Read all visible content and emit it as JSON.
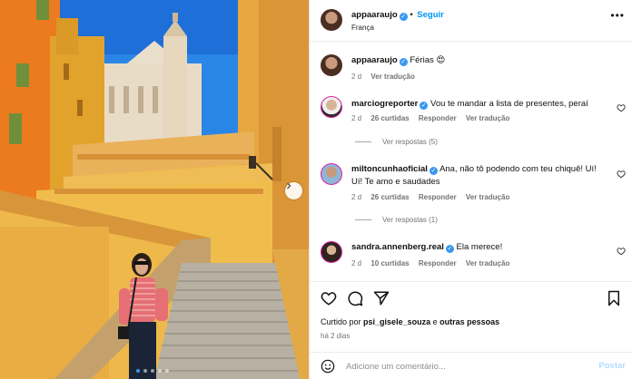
{
  "post": {
    "author": "appaaraujo",
    "follow_label": "Seguir",
    "location": "França",
    "caption_text": "Férias",
    "caption_emoji": "😍",
    "caption_time": "2 d",
    "see_translation": "Ver tradução"
  },
  "comments": [
    {
      "user": "marciogreporter",
      "text": "Vou te mandar a lista de presentes, peraí",
      "time": "2 d",
      "likes": "26 curtidas",
      "reply": "Responder",
      "translate": "Ver tradução",
      "replies_label": "Ver respostas (5)"
    },
    {
      "user": "miltoncunhaoficial",
      "text": "Ana, não tô podendo com teu chiquê! Uí! Uí! Te amo e saudades",
      "time": "2 d",
      "likes": "26 curtidas",
      "reply": "Responder",
      "translate": "Ver tradução",
      "replies_label": "Ver respostas (1)"
    },
    {
      "user": "sandra.annenberg.real",
      "text": "Ela merece!",
      "time": "2 d",
      "likes": "10 curtidas",
      "reply": "Responder",
      "translate": "Ver tradução"
    }
  ],
  "footer": {
    "liked_prefix": "Curtido por",
    "liked_user": "psi_gisele_souza",
    "liked_and": "e",
    "liked_others": "outras pessoas",
    "time": "há 2 dias",
    "comment_placeholder": "Adicione um comentário...",
    "post_label": "Postar"
  },
  "carousel": {
    "slides": 5,
    "active_index": 0
  },
  "colors": {
    "accent": "#0095f6",
    "verified": "#3897f0",
    "muted": "#737373"
  },
  "icons": [
    "verified-icon",
    "more-options-icon",
    "heart-icon",
    "comment-icon",
    "share-icon",
    "save-icon",
    "emoji-icon",
    "chevron-right-icon"
  ]
}
